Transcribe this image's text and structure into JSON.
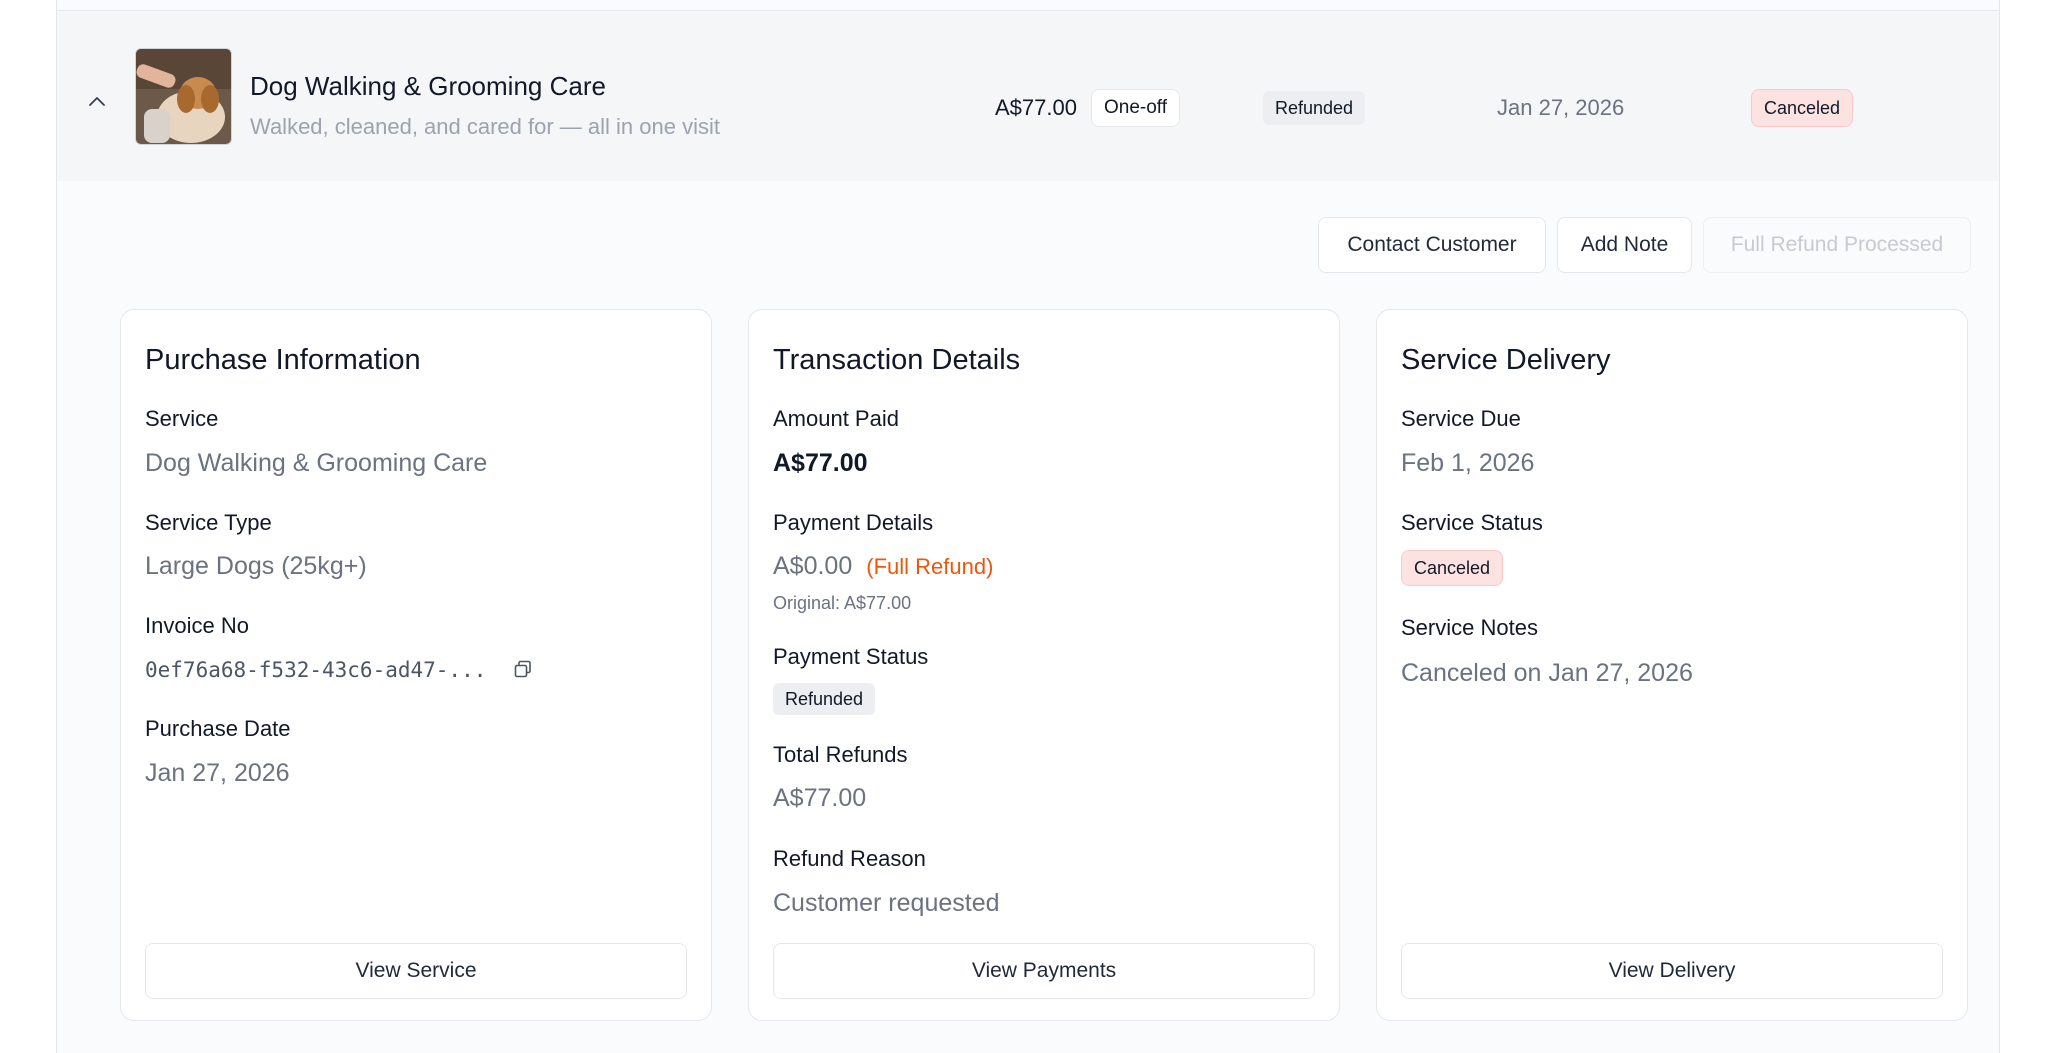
{
  "order": {
    "service_title": "Dog Walking & Grooming Care",
    "service_subtitle": "Walked, cleaned, and cared for — all in one visit",
    "price": "A$77.00",
    "billing_type": "One-off",
    "payment_status": "Refunded",
    "date": "Jan 27, 2026",
    "service_status": "Canceled",
    "thumbnail_icon": "dog-grooming-photo",
    "expand_icon": "chevron-up-icon"
  },
  "actions": {
    "contact_label": "Contact Customer",
    "note_label": "Add Note",
    "refund_label": "Full Refund Processed"
  },
  "purchase": {
    "title": "Purchase Information",
    "service_label": "Service",
    "service_value": "Dog Walking & Grooming Care",
    "type_label": "Service Type",
    "type_value": "Large Dogs (25kg+)",
    "invoice_label": "Invoice No",
    "invoice_value": "0ef76a68-f532-43c6-ad47-...",
    "date_label": "Purchase Date",
    "date_value": "Jan 27, 2026",
    "button_label": "View Service"
  },
  "transaction": {
    "title": "Transaction Details",
    "amount_label": "Amount Paid",
    "amount_value": "A$77.00",
    "details_label": "Payment Details",
    "details_value": "A$0.00",
    "details_note": "(Full Refund)",
    "original": "Original: A$77.00",
    "status_label": "Payment Status",
    "status_value": "Refunded",
    "refunds_label": "Total Refunds",
    "refunds_value": "A$77.00",
    "reason_label": "Refund Reason",
    "reason_value": "Customer requested",
    "button_label": "View Payments"
  },
  "delivery": {
    "title": "Service Delivery",
    "due_label": "Service Due",
    "due_value": "Feb 1, 2026",
    "status_label": "Service Status",
    "status_value": "Canceled",
    "notes_label": "Service Notes",
    "notes_value": "Canceled on Jan 27, 2026",
    "button_label": "View Delivery"
  },
  "colors": {
    "refund_accent": "#ea580c",
    "canceled_bg": "#fde2e2",
    "neutral_badge_bg": "#eceef1"
  }
}
